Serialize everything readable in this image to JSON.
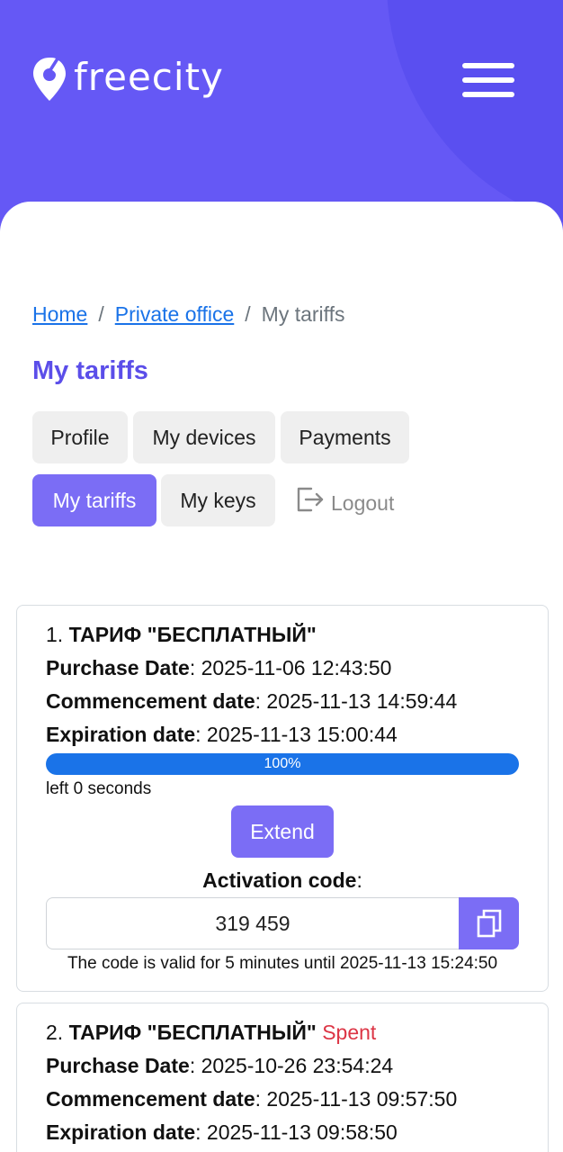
{
  "brand": {
    "name": "freecity"
  },
  "breadcrumb": {
    "home": "Home",
    "office": "Private office",
    "current": "My tariffs",
    "separator": "/"
  },
  "page": {
    "title": "My tariffs"
  },
  "tabs": {
    "profile": "Profile",
    "devices": "My devices",
    "payments": "Payments",
    "tariffs": "My tariffs",
    "keys": "My keys",
    "logout": "Logout"
  },
  "tariffs": [
    {
      "index": "1.",
      "name": "ТАРИФ \"БЕСПЛАТНЫЙ\"",
      "status": "",
      "purchase_label": "Purchase Date",
      "purchase": ": 2025-11-06 12:43:50",
      "commence_label": "Commencement date",
      "commence": ": 2025-11-13 14:59:44",
      "expire_label": "Expiration date",
      "expire": ": 2025-11-13 15:00:44",
      "progress_text": "100%",
      "progress_fraction": 1.0,
      "left": "left 0 seconds",
      "extend": "Extend",
      "activation_label": "Activation code",
      "activation_colon": ":",
      "code": "319 459",
      "valid_note": "The code is valid for 5 minutes until 2025-11-13 15:24:50"
    },
    {
      "index": "2.",
      "name": "ТАРИФ \"БЕСПЛАТНЫЙ\"",
      "status": "Spent",
      "purchase_label": "Purchase Date",
      "purchase": ": 2025-10-26 23:54:24",
      "commence_label": "Commencement date",
      "commence": ": 2025-11-13 09:57:50",
      "expire_label": "Expiration date",
      "expire": ": 2025-11-13 09:58:50"
    }
  ],
  "colors": {
    "header": "#6558f5",
    "accent": "#7b6df5",
    "title": "#5b4ee9",
    "link": "#1a73e8",
    "progress": "#1a73e8",
    "spent": "#dc3545"
  },
  "icons": {
    "logo": "map-pin-icon",
    "menu": "hamburger-icon",
    "logout": "logout-icon",
    "copy": "copy-icon"
  }
}
